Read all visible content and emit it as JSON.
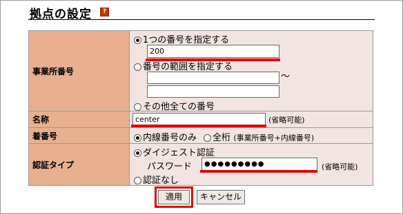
{
  "page": {
    "title": "拠点の設定",
    "help_icon": "?"
  },
  "office_number": {
    "label": "事業所番号",
    "option_single": "1つの番号を指定する",
    "single_value": "200",
    "option_range": "番号の範囲を指定する",
    "range_from": "",
    "range_to": "",
    "range_separator": "～",
    "option_all_others": "その他全ての番号"
  },
  "name": {
    "label": "名称",
    "value": "center",
    "note": "(省略可能)"
  },
  "incoming_number": {
    "label": "着番号",
    "option_extension": "内線番号のみ",
    "option_full": "全桁",
    "option_full_note": "(事業所番号+内線番号)"
  },
  "auth_type": {
    "label": "認証タイプ",
    "option_digest": "ダイジェスト認証",
    "password_label": "パスワード",
    "password_value": "●●●●●●●●●",
    "password_note": "(省略可能)",
    "option_none": "認証なし"
  },
  "buttons": {
    "apply": "適用",
    "cancel": "キャンセル"
  },
  "colors": {
    "label_bg": "#e8b08e",
    "value_bg": "#f1e4e1",
    "highlight": "#e00000"
  }
}
